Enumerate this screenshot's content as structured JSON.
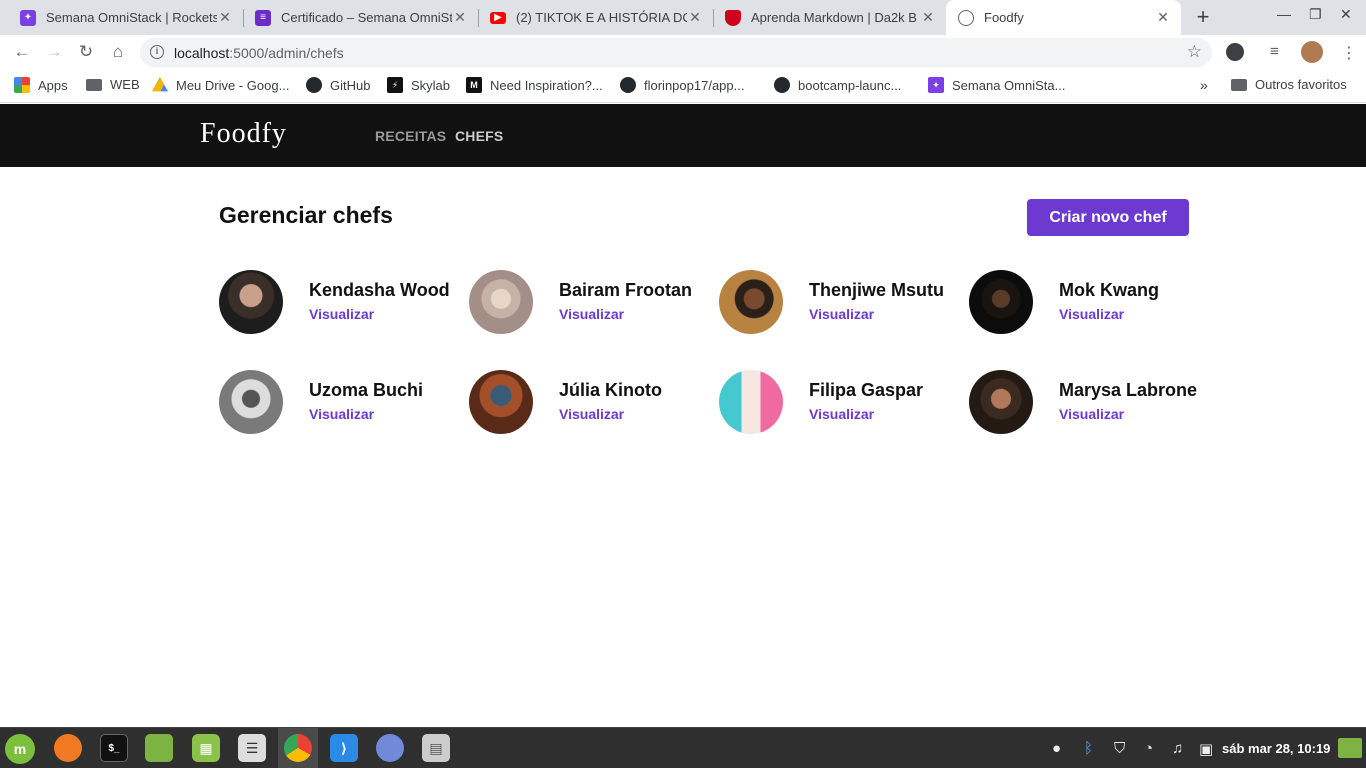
{
  "browser": {
    "tabs": [
      {
        "title": "Semana OmniStack | Rockets",
        "favicon_color": "#7b3fe4",
        "active": false
      },
      {
        "title": "Certificado – Semana OmniSt",
        "favicon_color": "#6c2dc7",
        "active": false
      },
      {
        "title": "(2) TIKTOK E A HISTÓRIA DO",
        "favicon_color": "#ff0000",
        "active": false
      },
      {
        "title": "Aprenda Markdown | Da2k B",
        "favicon_color": "#d0021b",
        "active": false
      },
      {
        "title": "Foodfy",
        "favicon_color": "#5f6368",
        "active": true
      }
    ],
    "url_host": "localhost",
    "url_path": ":5000/admin/chefs",
    "bookmarks": [
      {
        "label": "Apps",
        "icon": "apps-grid-icon"
      },
      {
        "label": "WEB",
        "icon": "folder-icon"
      },
      {
        "label": "Meu Drive - Goog...",
        "icon": "google-drive-icon"
      },
      {
        "label": "GitHub",
        "icon": "github-icon"
      },
      {
        "label": "Skylab",
        "icon": "skylab-icon"
      },
      {
        "label": "Need Inspiration?...",
        "icon": "medium-icon"
      },
      {
        "label": "florinpop17/app...",
        "icon": "github-icon"
      },
      {
        "label": "bootcamp-launc...",
        "icon": "github-icon"
      },
      {
        "label": "Semana OmniSta...",
        "icon": "rocketseat-icon"
      }
    ],
    "other_bookmarks": "Outros favoritos",
    "more_bookmarks": "»"
  },
  "site": {
    "logo": "Foodfy",
    "nav": [
      {
        "label": "RECEITAS",
        "active": false
      },
      {
        "label": "CHEFS",
        "active": true
      }
    ]
  },
  "main": {
    "title": "Gerenciar chefs",
    "create_button": "Criar novo chef",
    "chefs": [
      {
        "name": "Kendasha Wood",
        "link": "Visualizar"
      },
      {
        "name": "Bairam Frootan",
        "link": "Visualizar"
      },
      {
        "name": "Thenjiwe Msutu",
        "link": "Visualizar"
      },
      {
        "name": "Mok Kwang",
        "link": "Visualizar"
      },
      {
        "name": "Uzoma Buchi",
        "link": "Visualizar"
      },
      {
        "name": "Júlia Kinoto",
        "link": "Visualizar"
      },
      {
        "name": "Filipa Gaspar",
        "link": "Visualizar"
      },
      {
        "name": "Marysa Labrone",
        "link": "Visualizar"
      }
    ]
  },
  "taskbar": {
    "clock": "sáb mar 28, 10:19"
  }
}
